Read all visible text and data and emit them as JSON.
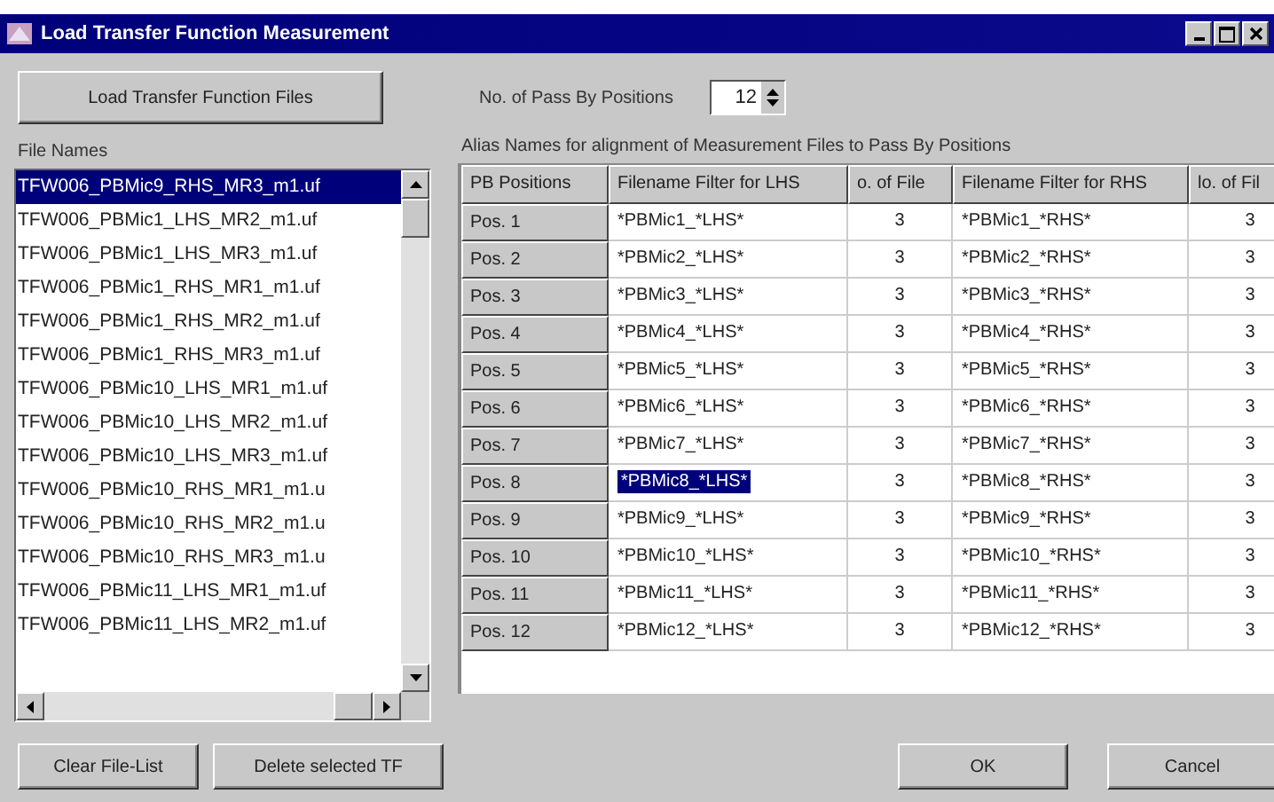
{
  "window": {
    "title": "Load Transfer Function Measurement"
  },
  "load_button": "Load Transfer Function Files",
  "pass_by": {
    "label": "No. of Pass By Positions",
    "value": "12"
  },
  "file_list": {
    "label": "File Names",
    "items": [
      {
        "name": "TFW006_PBMic9_RHS_MR3_m1.uf",
        "selected": true
      },
      {
        "name": "TFW006_PBMic1_LHS_MR2_m1.uf",
        "selected": false
      },
      {
        "name": "TFW006_PBMic1_LHS_MR3_m1.uf",
        "selected": false
      },
      {
        "name": "TFW006_PBMic1_RHS_MR1_m1.uf",
        "selected": false
      },
      {
        "name": "TFW006_PBMic1_RHS_MR2_m1.uf",
        "selected": false
      },
      {
        "name": "TFW006_PBMic1_RHS_MR3_m1.uf",
        "selected": false
      },
      {
        "name": "TFW006_PBMic10_LHS_MR1_m1.uf",
        "selected": false
      },
      {
        "name": "TFW006_PBMic10_LHS_MR2_m1.uf",
        "selected": false
      },
      {
        "name": "TFW006_PBMic10_LHS_MR3_m1.uf",
        "selected": false
      },
      {
        "name": "TFW006_PBMic10_RHS_MR1_m1.u",
        "selected": false
      },
      {
        "name": "TFW006_PBMic10_RHS_MR2_m1.u",
        "selected": false
      },
      {
        "name": "TFW006_PBMic10_RHS_MR3_m1.u",
        "selected": false
      },
      {
        "name": "TFW006_PBMic11_LHS_MR1_m1.uf",
        "selected": false
      },
      {
        "name": "TFW006_PBMic11_LHS_MR2_m1.uf",
        "selected": false
      }
    ]
  },
  "alias": {
    "label": "Alias Names for alignment of Measurement Files to Pass By Positions",
    "table": {
      "columns": [
        "PB Positions",
        "Filename Filter for LHS",
        "o. of File",
        "Filename Filter for RHS",
        "lo. of Fil"
      ],
      "rows": [
        {
          "position": "Pos. 1",
          "lhs": "*PBMic1_*LHS*",
          "lhs_count": "3",
          "rhs": "*PBMic1_*RHS*",
          "rhs_count": "3",
          "selected": false
        },
        {
          "position": "Pos. 2",
          "lhs": "*PBMic2_*LHS*",
          "lhs_count": "3",
          "rhs": "*PBMic2_*RHS*",
          "rhs_count": "3",
          "selected": false
        },
        {
          "position": "Pos. 3",
          "lhs": "*PBMic3_*LHS*",
          "lhs_count": "3",
          "rhs": "*PBMic3_*RHS*",
          "rhs_count": "3",
          "selected": false
        },
        {
          "position": "Pos. 4",
          "lhs": "*PBMic4_*LHS*",
          "lhs_count": "3",
          "rhs": "*PBMic4_*RHS*",
          "rhs_count": "3",
          "selected": false
        },
        {
          "position": "Pos. 5",
          "lhs": "*PBMic5_*LHS*",
          "lhs_count": "3",
          "rhs": "*PBMic5_*RHS*",
          "rhs_count": "3",
          "selected": false
        },
        {
          "position": "Pos. 6",
          "lhs": "*PBMic6_*LHS*",
          "lhs_count": "3",
          "rhs": "*PBMic6_*RHS*",
          "rhs_count": "3",
          "selected": false
        },
        {
          "position": "Pos. 7",
          "lhs": "*PBMic7_*LHS*",
          "lhs_count": "3",
          "rhs": "*PBMic7_*RHS*",
          "rhs_count": "3",
          "selected": false
        },
        {
          "position": "Pos. 8",
          "lhs": "*PBMic8_*LHS*",
          "lhs_count": "3",
          "rhs": "*PBMic8_*RHS*",
          "rhs_count": "3",
          "selected": true
        },
        {
          "position": "Pos. 9",
          "lhs": "*PBMic9_*LHS*",
          "lhs_count": "3",
          "rhs": "*PBMic9_*RHS*",
          "rhs_count": "3",
          "selected": false
        },
        {
          "position": "Pos. 10",
          "lhs": "*PBMic10_*LHS*",
          "lhs_count": "3",
          "rhs": "*PBMic10_*RHS*",
          "rhs_count": "3",
          "selected": false
        },
        {
          "position": "Pos. 11",
          "lhs": "*PBMic11_*LHS*",
          "lhs_count": "3",
          "rhs": "*PBMic11_*RHS*",
          "rhs_count": "3",
          "selected": false
        },
        {
          "position": "Pos. 12",
          "lhs": "*PBMic12_*LHS*",
          "lhs_count": "3",
          "rhs": "*PBMic12_*RHS*",
          "rhs_count": "3",
          "selected": false
        }
      ]
    }
  },
  "buttons": [
    "Clear File-List",
    "Delete selected TF",
    "OK",
    "Cancel"
  ]
}
